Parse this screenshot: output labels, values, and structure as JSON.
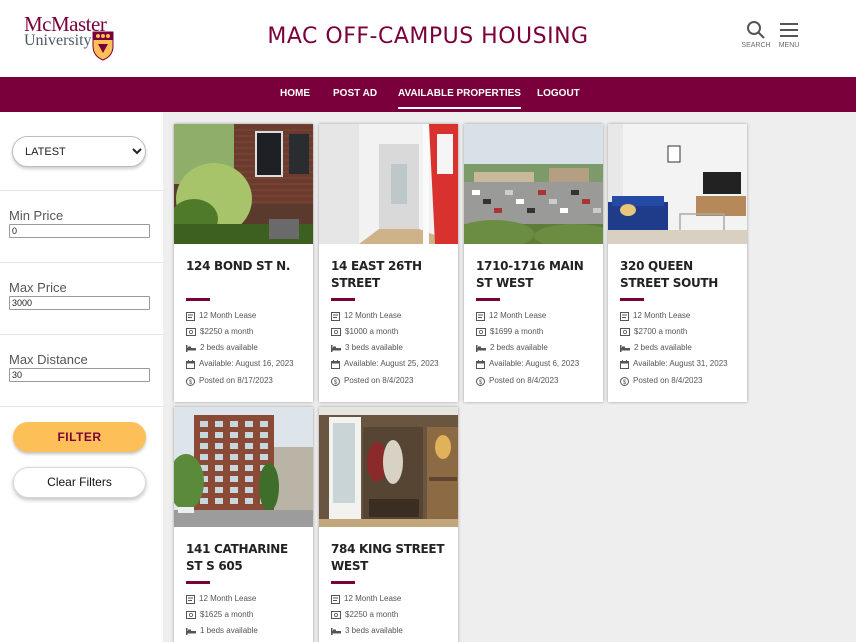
{
  "header": {
    "logo_line1": "McMaster",
    "logo_line2": "University",
    "title": "MAC OFF-CAMPUS HOUSING",
    "search_label": "SEARCH",
    "menu_label": "MENU"
  },
  "nav": {
    "home": "HOME",
    "post_ad": "POST AD",
    "available": "AVAILABLE PROPERTIES",
    "logout": "LOGOUT"
  },
  "sidebar": {
    "sort_options": [
      "LATEST"
    ],
    "sort_selected": "LATEST",
    "min_price_label": "Min Price",
    "min_price_value": "0",
    "max_price_label": "Max Price",
    "max_price_value": "3000",
    "max_distance_label": "Max Distance",
    "max_distance_value": "30",
    "filter_label": "FILTER",
    "clear_label": "Clear Filters"
  },
  "listings": [
    {
      "title": "124 BOND ST N.",
      "lease": "12 Month Lease",
      "price": "$2250 a month",
      "beds": "2 beds available",
      "available": "Available: August 16, 2023",
      "posted": "Posted on 8/17/2023",
      "image": "brick-house-garden"
    },
    {
      "title": "14 EAST 26TH STREET",
      "lease": "12 Month Lease",
      "price": "$1000 a month",
      "beds": "3 beds available",
      "available": "Available: August 25, 2023",
      "posted": "Posted on 8/4/2023",
      "image": "hallway-red-door"
    },
    {
      "title": "1710-1716 MAIN ST WEST",
      "lease": "12 Month Lease",
      "price": "$1699 a month",
      "beds": "2 beds available",
      "available": "Available: August 6, 2023",
      "posted": "Posted on 8/4/2023",
      "image": "parking-lot-view"
    },
    {
      "title": "320 QUEEN STREET SOUTH",
      "lease": "12 Month Lease",
      "price": "$2700 a month",
      "beds": "2 beds available",
      "available": "Available: August 31, 2023",
      "posted": "Posted on 8/4/2023",
      "image": "living-room"
    },
    {
      "title": "141 CATHARINE ST S 605",
      "lease": "12 Month Lease",
      "price": "$1625 a month",
      "beds": "1 beds available",
      "available": "",
      "posted": "",
      "image": "apartment-building"
    },
    {
      "title": "784 KING STREET WEST",
      "lease": "12 Month Lease",
      "price": "$2250 a month",
      "beds": "3 beds available",
      "available": "",
      "posted": "",
      "image": "entryway-closet"
    }
  ],
  "colors": {
    "brand_maroon": "#7a003c",
    "brand_gold": "#fdbf57",
    "page_bg": "#eeeeee"
  },
  "icons": [
    "search-icon",
    "menu-icon",
    "lease-icon",
    "price-icon",
    "bed-icon",
    "calendar-icon",
    "dollar-icon"
  ]
}
